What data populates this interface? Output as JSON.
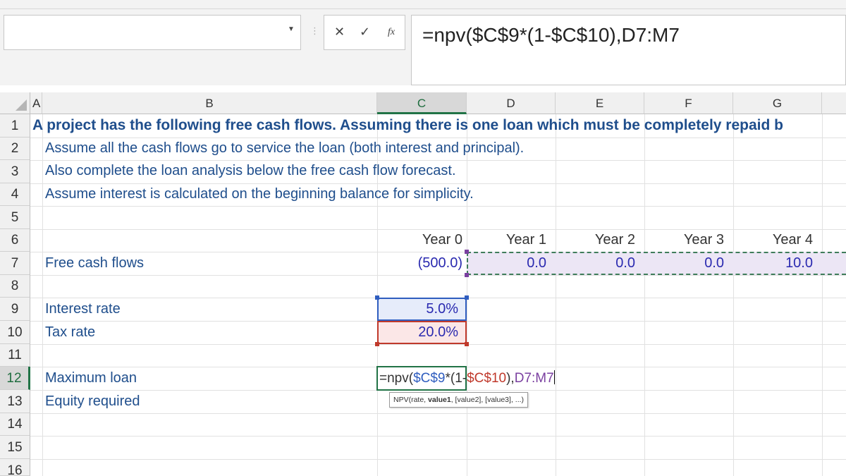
{
  "formula_bar": {
    "name_box": "",
    "cancel_icon": "✕",
    "enter_icon": "✓",
    "fx_label": "fx",
    "formula": "=npv($C$9*(1-$C$10),D7:M7"
  },
  "columns": [
    "A",
    "B",
    "C",
    "D",
    "E",
    "F",
    "G"
  ],
  "rows": [
    "1",
    "2",
    "3",
    "4",
    "5",
    "6",
    "7",
    "8",
    "9",
    "10",
    "11",
    "12",
    "13",
    "14",
    "15",
    "16"
  ],
  "cells": {
    "A1": "A project has the following free cash flows. Assuming there is one loan which must be completely repaid b",
    "B2": "Assume all the cash flows go to service the loan (both interest and principal).",
    "B3": "Also complete the loan analysis below the free cash flow forecast.",
    "B4": "Assume interest is calculated on the beginning balance for simplicity.",
    "C6": "Year 0",
    "D6": "Year 1",
    "E6": "Year 2",
    "F6": "Year 3",
    "G6": "Year 4",
    "B7": "Free cash flows",
    "C7": "(500.0)",
    "D7": "0.0",
    "E7": "0.0",
    "F7": "0.0",
    "G7": "10.0",
    "B9": "Interest rate",
    "C9": "5.0%",
    "B10": "Tax rate",
    "C10": "20.0%",
    "B12": "Maximum loan",
    "B13": "Equity required"
  },
  "edit_cell": {
    "p1": "=npv(",
    "p2": "$C$9",
    "p3": "*(1-",
    "p4": "$C$10",
    "p5": "),",
    "p6": "D7:M7"
  },
  "tooltip": {
    "fn": "NPV(rate, ",
    "bold": "value1",
    "rest": ", [value2], [value3], ...)"
  },
  "colors": {
    "ref_blue": "#2f5dbf",
    "ref_red": "#c0392b",
    "ref_purple": "#7a3fa0",
    "selection_green": "#217346"
  }
}
